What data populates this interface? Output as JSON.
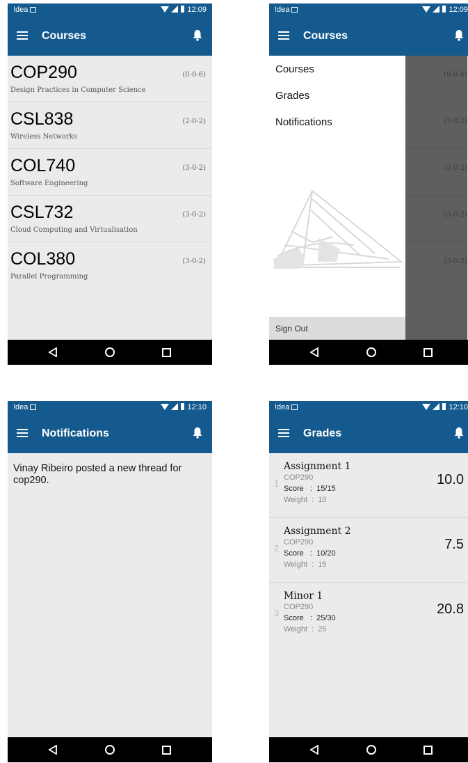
{
  "status": {
    "carrier": "!dea",
    "time_1": "12:09",
    "time_2": "12:09",
    "time_3": "12:10",
    "time_4": "12:10"
  },
  "screen_courses": {
    "title": "Courses",
    "courses": [
      {
        "code": "COP290",
        "name": "Design Practices in Computer Science",
        "credits": "(0-0-6)"
      },
      {
        "code": "CSL838",
        "name": "Wireless Networks",
        "credits": "(2-0-2)"
      },
      {
        "code": "COL740",
        "name": "Software Engineering",
        "credits": "(3-0-2)"
      },
      {
        "code": "CSL732",
        "name": "Cloud Computing and Virtualisation",
        "credits": "(3-0-2)"
      },
      {
        "code": "COL380",
        "name": "Parallel Programming",
        "credits": "(3-0-2)"
      }
    ]
  },
  "screen_drawer": {
    "title": "Courses",
    "menu": [
      "Courses",
      "Grades",
      "Notifications"
    ],
    "signout": "Sign Out",
    "dim_credits": [
      "(0-0-6)",
      "(2-0-2)",
      "(3-0-2)",
      "(3-0-2)",
      "(3-0-2)"
    ]
  },
  "screen_notifications": {
    "title": "Notifications",
    "message": "Vinay Ribeiro posted a new thread for cop290."
  },
  "screen_grades": {
    "title": "Grades",
    "items": [
      {
        "index": "1",
        "title": "Assignment 1",
        "course": "COP290",
        "score": "Score   :  15/15",
        "weight": "Weight  :  10",
        "value": "10.0"
      },
      {
        "index": "2",
        "title": "Assignment 2",
        "course": "COP290",
        "score": "Score   :  10/20",
        "weight": "Weight  :  15",
        "value": "7.5"
      },
      {
        "index": "3",
        "title": "Minor 1",
        "course": "COP290",
        "score": "Score   :  25/30",
        "weight": "Weight  :  25",
        "value": "20.8"
      }
    ]
  }
}
